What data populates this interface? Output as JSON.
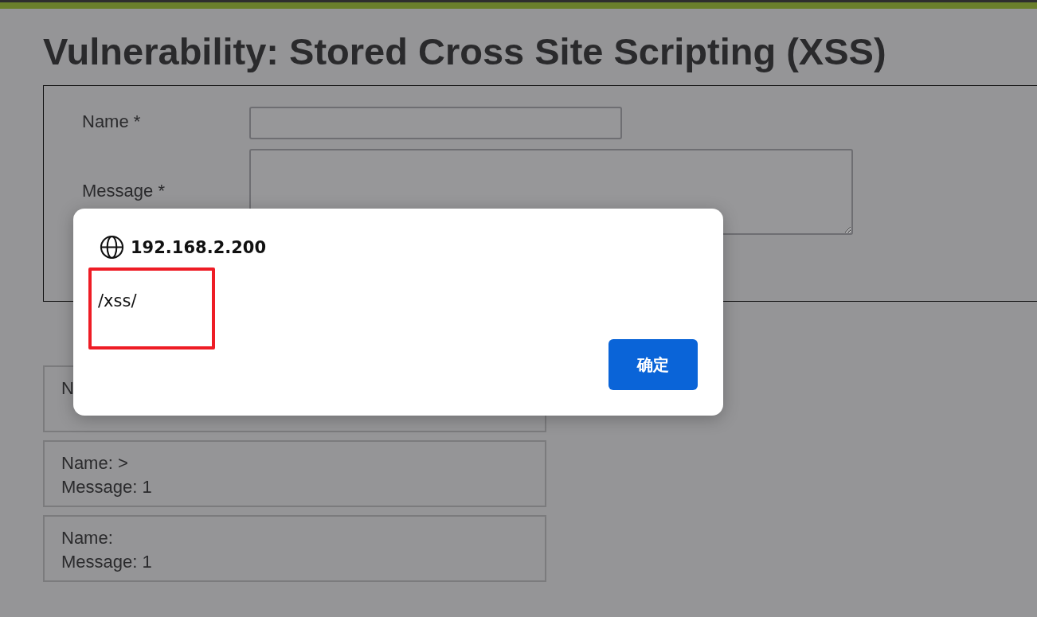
{
  "page": {
    "heading": "Vulnerability: Stored Cross Site Scripting (XSS)"
  },
  "form": {
    "fields": [
      {
        "label": "Name *",
        "kind": "input"
      },
      {
        "label": "Message *",
        "kind": "textarea"
      }
    ]
  },
  "guestbook": [
    {
      "name_line": "N"
    },
    {
      "name_line": "Name: >",
      "message_line": "Message: 1"
    },
    {
      "name_line": "Name:",
      "message_line": "Message: 1"
    }
  ],
  "alert_dialog": {
    "origin": "192.168.2.200",
    "message": "/xss/",
    "highlighted": true,
    "button": "确定"
  }
}
